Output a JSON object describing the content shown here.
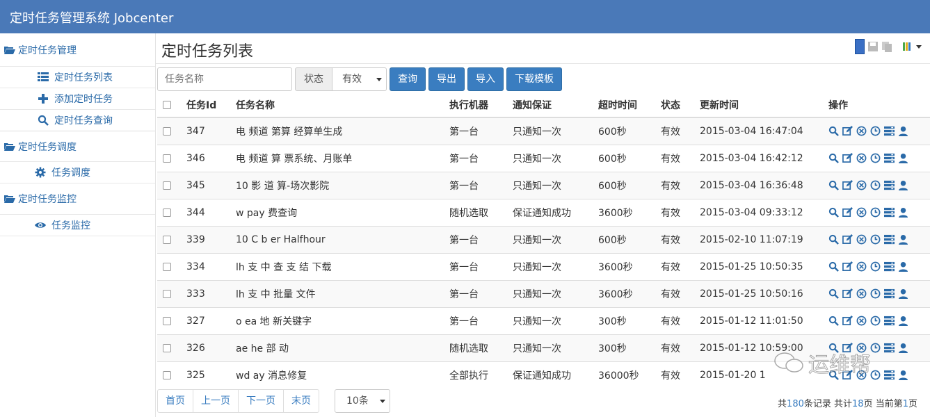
{
  "app": {
    "title": "定时任务管理系统 Jobcenter"
  },
  "sidebar": {
    "groups": [
      {
        "label": "定时任务管理",
        "items": [
          {
            "label": "定时任务列表",
            "icon": "list-icon"
          },
          {
            "label": "添加定时任务",
            "icon": "plus-icon"
          },
          {
            "label": "定时任务查询",
            "icon": "search-icon"
          }
        ]
      },
      {
        "label": "定时任务调度",
        "items": [
          {
            "label": "任务调度",
            "icon": "gear-icon"
          }
        ]
      },
      {
        "label": "定时任务监控",
        "items": [
          {
            "label": "任务监控",
            "icon": "eye-icon"
          }
        ]
      }
    ]
  },
  "page": {
    "title": "定时任务列表"
  },
  "filter": {
    "name_placeholder": "任务名称",
    "status_label": "状态",
    "status_value": "有效",
    "buttons": {
      "query": "查询",
      "export": "导出",
      "import": "导入",
      "download_template": "下载模板"
    }
  },
  "table": {
    "headers": {
      "id": "任务Id",
      "name": "任务名称",
      "machine": "执行机器",
      "notify": "通知保证",
      "timeout": "超时时间",
      "status": "状态",
      "updated": "更新时间",
      "ops": "操作"
    },
    "rows": [
      {
        "id": "347",
        "name": "电 频道 第算 经算单生成",
        "machine": "第一台",
        "notify": "只通知一次",
        "timeout": "600秒",
        "status": "有效",
        "updated": "2015-03-04 16:47:04"
      },
      {
        "id": "346",
        "name": "电 频道 算 票系统、月账单",
        "machine": "第一台",
        "notify": "只通知一次",
        "timeout": "600秒",
        "status": "有效",
        "updated": "2015-03-04 16:42:12"
      },
      {
        "id": "345",
        "name": "10 影 道 算-场次影院",
        "machine": "第一台",
        "notify": "只通知一次",
        "timeout": "600秒",
        "status": "有效",
        "updated": "2015-03-04 16:36:48"
      },
      {
        "id": "344",
        "name": "w pay 费查询",
        "machine": "随机选取",
        "notify": "保证通知成功",
        "timeout": "3600秒",
        "status": "有效",
        "updated": "2015-03-04 09:33:12"
      },
      {
        "id": "339",
        "name": "10 C b er Halfhour",
        "machine": "第一台",
        "notify": "只通知一次",
        "timeout": "600秒",
        "status": "有效",
        "updated": "2015-02-10 11:07:19"
      },
      {
        "id": "334",
        "name": "lh 支 中 查 支 结 下载",
        "machine": "第一台",
        "notify": "只通知一次",
        "timeout": "3600秒",
        "status": "有效",
        "updated": "2015-01-25 10:50:35"
      },
      {
        "id": "333",
        "name": "lh 支 中 批量 文件",
        "machine": "第一台",
        "notify": "只通知一次",
        "timeout": "3600秒",
        "status": "有效",
        "updated": "2015-01-25 10:50:16"
      },
      {
        "id": "327",
        "name": "o ea 地 新关键字",
        "machine": "第一台",
        "notify": "只通知一次",
        "timeout": "300秒",
        "status": "有效",
        "updated": "2015-01-12 11:01:50"
      },
      {
        "id": "326",
        "name": "ae he 部 动",
        "machine": "随机选取",
        "notify": "只通知一次",
        "timeout": "300秒",
        "status": "有效",
        "updated": "2015-01-12 10:59:00"
      },
      {
        "id": "325",
        "name": "wd ay 消息修复",
        "machine": "全部执行",
        "notify": "保证通知成功",
        "timeout": "36000秒",
        "status": "有效",
        "updated": "2015-01-20 1"
      }
    ]
  },
  "pager": {
    "first": "首页",
    "prev": "上一页",
    "next": "下一页",
    "last": "末页",
    "page_size": "10条",
    "summary": {
      "pre": "共",
      "total": "180",
      "mid1": "条记录 共计",
      "pages": "18",
      "mid2": "页 当前第",
      "current": "1",
      "post": "页"
    }
  },
  "watermark": {
    "text": "运维帮"
  },
  "colors": {
    "header": "#4a79b8",
    "primary": "#3a7dc0",
    "link": "#2a6aa8"
  }
}
